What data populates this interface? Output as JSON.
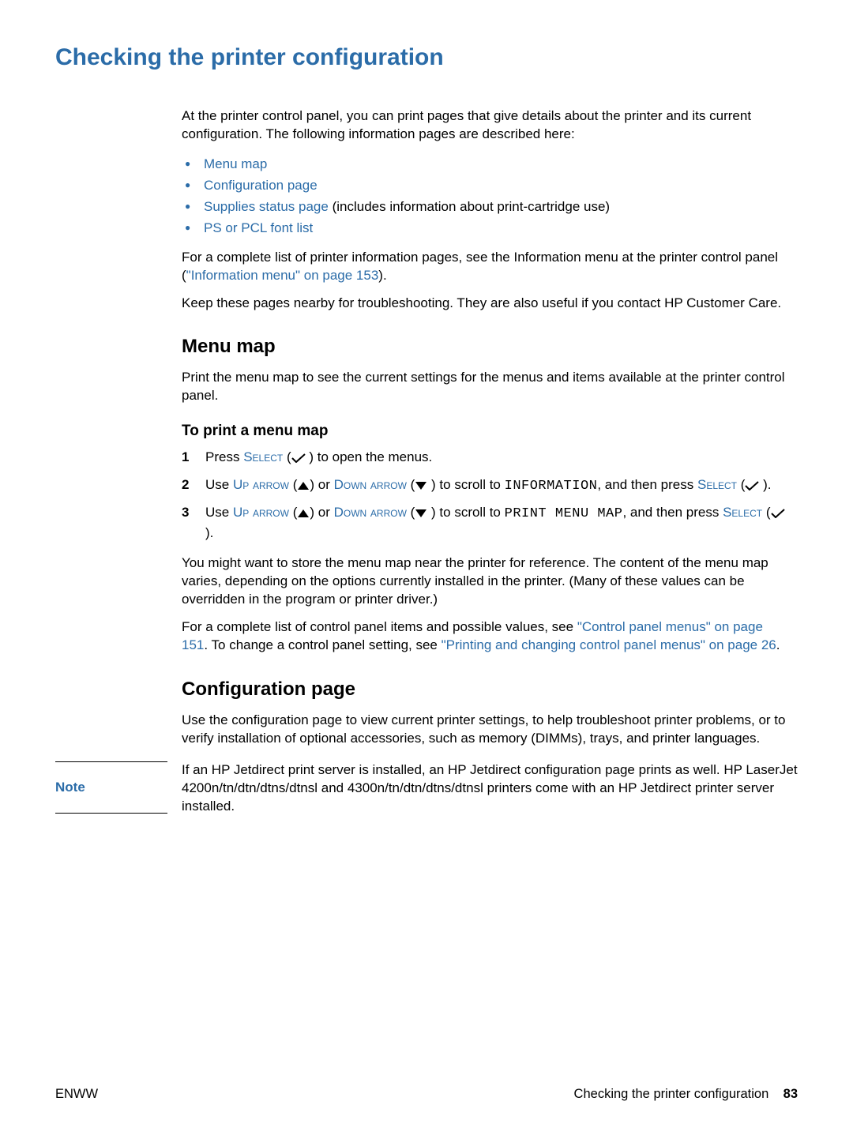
{
  "title": "Checking the printer configuration",
  "intro": "At the printer control panel, you can print pages that give details about the printer and its current configuration. The following information pages are described here:",
  "bullets": {
    "menu_map": "Menu map",
    "config_page": "Configuration page",
    "supplies_link": "Supplies status page",
    "supplies_suffix": " (includes information about print-cartridge use)",
    "ps_pcl": "PS or PCL font list"
  },
  "para_complete_list_pre": "For a complete list of printer information pages, see the Information menu at the printer control panel (",
  "para_complete_list_link": "\"Information menu\" on page 153",
  "para_complete_list_post": ").",
  "para_keep": "Keep these pages nearby for troubleshooting. They are also useful if you contact HP Customer Care.",
  "menu_map": {
    "heading": "Menu map",
    "desc": "Print the menu map to see the current settings for the menus and items available at the printer control panel.",
    "sub": "To print a menu map",
    "step1_pre": "Press ",
    "select": "Select",
    "step1_post": " ( ",
    "step1_end": " ) to open the menus.",
    "step23_pre": "Use ",
    "up_arrow": "Up arrow",
    "or": " or ",
    "down_arrow": "Down arrow",
    "step2_mid": " ) to scroll to ",
    "info_mono": "INFORMATION",
    "step2_mid2": ", and then press ",
    "step2_end": " ).",
    "print_menu_map_mono": "PRINT MENU MAP",
    "step3_mid2": ", and then press ",
    "store": "You might want to store the menu map near the printer for reference. The content of the menu map varies, depending on the options currently installed in the printer. (Many of these values can be overridden in the program or printer driver.)",
    "ref_pre": "For a complete list of control panel items and possible values, see ",
    "ref_link1": "\"Control panel menus\" on page 151",
    "ref_mid": ". To change a control panel setting, see ",
    "ref_link2": "\"Printing and changing control panel menus\" on page 26",
    "ref_post": "."
  },
  "config_page": {
    "heading": "Configuration page",
    "desc": "Use the configuration page to view current printer settings, to help troubleshoot printer problems, or to verify installation of optional accessories, such as memory (DIMMs), trays, and printer languages."
  },
  "note": {
    "label": "Note",
    "text": "If an HP Jetdirect print server is installed, an HP Jetdirect configuration page prints as well. HP LaserJet 4200n/tn/dtn/dtns/dtnsl and 4300n/tn/dtn/dtns/dtnsl printers come with an HP Jetdirect printer server installed."
  },
  "footer": {
    "left": "ENWW",
    "right_text": "Checking the printer configuration",
    "page": "83"
  }
}
